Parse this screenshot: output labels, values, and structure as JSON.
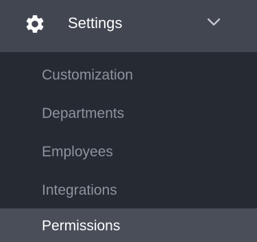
{
  "menu": {
    "header": {
      "icon": "gear-icon",
      "title": "Settings",
      "chevron": "chevron-down-icon",
      "expanded": true
    },
    "items": [
      {
        "label": "Customization",
        "active": false
      },
      {
        "label": "Departments",
        "active": false
      },
      {
        "label": "Employees",
        "active": false
      },
      {
        "label": "Integrations",
        "active": false
      },
      {
        "label": "Permissions",
        "active": true
      }
    ]
  },
  "colors": {
    "header_bg": "#424651",
    "submenu_bg": "#262a33",
    "active_bg": "#4a4e59",
    "text_muted": "#8e939c",
    "text_active": "#ffffff"
  }
}
